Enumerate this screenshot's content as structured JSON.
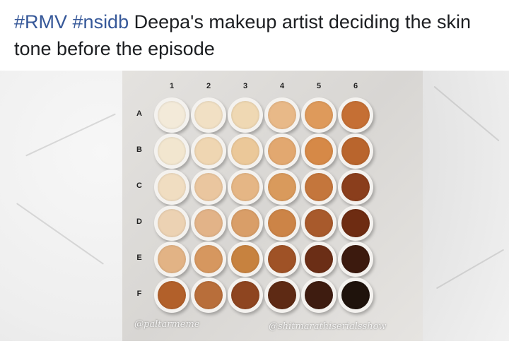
{
  "post": {
    "hashtag1": "#RMV",
    "hashtag2": "#nsidb",
    "line1_rest": " Deepa's makeup artist deciding the skin",
    "line2": "tone before the episode"
  },
  "image": {
    "columns": [
      "1",
      "2",
      "3",
      "4",
      "5",
      "6"
    ],
    "rows": [
      "A",
      "B",
      "C",
      "D",
      "E",
      "F"
    ],
    "swatch_colors": [
      [
        "#f3ead9",
        "#f1e0c4",
        "#efd8b3",
        "#e8b988",
        "#de9a5b",
        "#c56f34"
      ],
      [
        "#f2e6cf",
        "#efd6b2",
        "#ebc899",
        "#e2a870",
        "#d68947",
        "#b9652d"
      ],
      [
        "#f0ddc1",
        "#eac69f",
        "#e5b685",
        "#d99a5c",
        "#c4763c",
        "#8a3e1c"
      ],
      [
        "#ecd2b3",
        "#e2b388",
        "#d99e68",
        "#cc8447",
        "#a85a2c",
        "#6e2c12"
      ],
      [
        "#e2b385",
        "#d6975f",
        "#c7823f",
        "#9f5226",
        "#6b2e16",
        "#3c1a0e"
      ],
      [
        "#b2602a",
        "#b86e3a",
        "#8e4520",
        "#5e2a14",
        "#3e1c10",
        "#1f130c"
      ]
    ],
    "watermark_left": "@paltarmeme",
    "watermark_right": "@shitmarathiserialsshow"
  },
  "colors": {
    "text": "#1c1e21",
    "hashtag": "#365899"
  }
}
